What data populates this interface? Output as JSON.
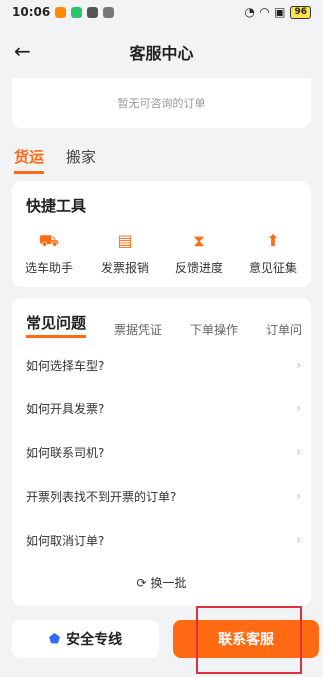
{
  "status_bar": {
    "time": "10:06",
    "battery": "96"
  },
  "nav": {
    "title": "客服中心"
  },
  "orders": {
    "empty_text": "暂无可咨询的订单"
  },
  "biz_tabs": [
    "货运",
    "搬家"
  ],
  "tools": {
    "title": "快捷工具",
    "items": [
      {
        "label": "选车助手",
        "icon": "truck-icon"
      },
      {
        "label": "发票报销",
        "icon": "invoice-icon"
      },
      {
        "label": "反馈进度",
        "icon": "hourglass-icon"
      },
      {
        "label": "意见征集",
        "icon": "feedback-icon"
      }
    ]
  },
  "faq": {
    "tabs": [
      "常见问题",
      "票据凭证",
      "下单操作",
      "订单问"
    ],
    "questions": [
      "如何选择车型?",
      "如何开具发票?",
      "如何联系司机?",
      "开票列表找不到开票的订单?",
      "如何取消订单?"
    ],
    "refresh": "换一批"
  },
  "bottom": {
    "safety": "安全专线",
    "contact": "联系客服"
  },
  "colors": {
    "accent": "#ff6a13",
    "shield": "#2f6bff",
    "highlight": "#e0303a"
  }
}
